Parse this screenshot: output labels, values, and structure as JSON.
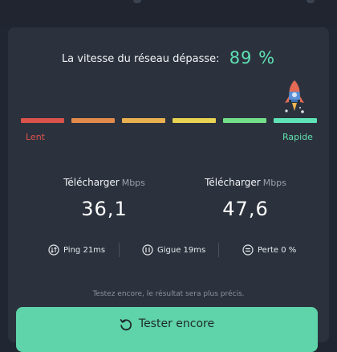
{
  "headline": {
    "text": "La vitesse du réseau dépasse:",
    "percent": "89 %"
  },
  "speed_scale": {
    "slow_label": "Lent",
    "fast_label": "Rapide",
    "segment_colors": [
      "#d9534b",
      "#e28a4c",
      "#e9b04f",
      "#e8d352",
      "#73e089",
      "#5fe3b6"
    ]
  },
  "download_left": {
    "title": "Télécharger",
    "unit": "Mbps",
    "value": "36,1"
  },
  "download_right": {
    "title": "Télécharger",
    "unit": "Mbps",
    "value": "47,6"
  },
  "stats": {
    "ping": {
      "label": "Ping 21ms",
      "icon": "ping-icon"
    },
    "jitter": {
      "label": "Gigue 19ms",
      "icon": "jitter-icon"
    },
    "loss": {
      "label": "Perte 0 %",
      "icon": "loss-icon"
    }
  },
  "hint": "Testez encore, le résultat sera plus précis.",
  "retest_button": {
    "label": "Tester encore",
    "icon": "refresh-icon"
  },
  "colors": {
    "accent": "#5ee0b4",
    "button": "#5fd3a9",
    "card": "#2c323d",
    "background": "#202632"
  }
}
